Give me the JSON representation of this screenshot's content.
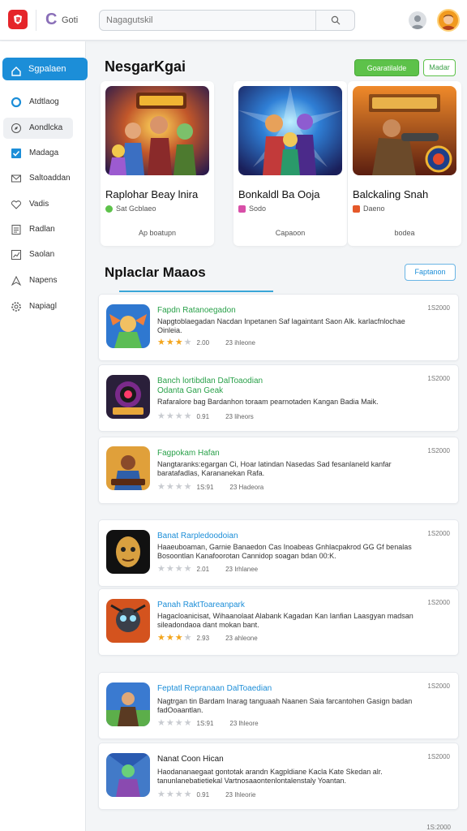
{
  "header": {
    "app_initial": "C",
    "app_name": "Goti",
    "search_placeholder": "Nagagutskil"
  },
  "sidebar": {
    "active": {
      "label": "Sgpalaen"
    },
    "items": [
      {
        "label": "Atdtlaog",
        "icon": "circle-icon"
      },
      {
        "label": "Aondlcka",
        "icon": "compass-icon"
      },
      {
        "label": "Madaga",
        "icon": "check-icon"
      },
      {
        "label": "Saltoaddan",
        "icon": "mail-icon"
      },
      {
        "label": "Vadis",
        "icon": "heart-icon"
      },
      {
        "label": "Radlan",
        "icon": "document-icon"
      },
      {
        "label": "Saolan",
        "icon": "chart-icon"
      },
      {
        "label": "Napens",
        "icon": "arrow-icon"
      },
      {
        "label": "Napiagl",
        "icon": "gear-icon"
      }
    ]
  },
  "featured": {
    "title": "NesgarKgai",
    "primary_button": "Goaratilalde",
    "secondary_button": "Madar",
    "cards": [
      {
        "title": "Raplohar Beay lnira",
        "sub": "Sat Gcblaeo",
        "link": "Ap boatupn",
        "dot_color": "#5dc24a"
      },
      {
        "title": "Bonkaldl Ba Ooja",
        "sub": "Sodo",
        "link": "Capaoon",
        "dot_color": "#d84fa8"
      },
      {
        "title": "Balckaling Snah",
        "sub": "Daeno",
        "link": "bodea",
        "dot_color": "#e5592a"
      }
    ]
  },
  "list_section": {
    "title": "Nplaclar Maaos",
    "button": "Faptanon"
  },
  "list_items": [
    {
      "title": "Fapdn Ratanoegadon",
      "desc": "Napgtoblaegadan Nacdan Inpetanen Saf lagaintant Saon Alk. karlacfnlochae Oinleia.",
      "rating": "2.00",
      "rating_stars": 3,
      "downloads": "23 ihleone",
      "date": "1S2000"
    },
    {
      "title": "Banch lortibdlan DalToaodian",
      "subtitle": "Odanta Gan Geak",
      "desc": "Rafaralore bag Bardanhon toraam pearnotaden Kangan Badia Maik.",
      "rating": "0.91",
      "rating_stars": 0,
      "downloads": "23 liheors",
      "date": "1S2000"
    },
    {
      "title": "Fagpokam Hafan",
      "desc": "Nangtaranks:egargan Ci, Hoar latindan Nasedas Sad fesanlaneld kanfar baratafadlas, Karananekan Rafa.",
      "rating": "1S:91",
      "rating_stars": 0,
      "downloads": "23 Hadeora",
      "date": "1S2000"
    },
    {
      "title": "Banat Rarpledoodoian",
      "desc": "Haaeuboaman, Garnie Banaedon Cas Inoabeas Gnhlacpakrod GG Gf benalas Bosoontlan Kanafoorotan Cannidop soagan bdan 00:K.",
      "rating": "2.01",
      "rating_stars": 0,
      "downloads": "23 Irhlanee",
      "date": "1S2000"
    },
    {
      "title": "Panah RaktToareanpark",
      "desc": "Hagacloanicisat, Wihaanolaat Alabank Kagadan Kan Ianfian Laasgyan madsan sileadondaoa dant mokan bant.",
      "rating": "2.93",
      "rating_stars": 3,
      "downloads": "23 ahleone",
      "date": "1S2000"
    },
    {
      "title": "Feptatl Repranaan DalToaedian",
      "desc": "Nagtrgan tin Bardam Inarag tanguaah Naanen Saia farcantohen Gasign badan fadOoaantlan.",
      "rating": "1S:91",
      "rating_stars": 0,
      "downloads": "23 lhleore",
      "date": "1S2000"
    },
    {
      "title": "Nanat Coon Hican",
      "desc": "Haodananaegaat gontotak arandn Kagpldiane Kacla Kate Skedan alr. tanunlanebatietiekal Vartnosaaontenlontalenstaly Yoantan.",
      "rating": "0.91",
      "rating_stars": 0,
      "downloads": "23 Ihleorie",
      "date": "1S2000"
    }
  ],
  "footer_date": "1S:2000",
  "colors": {
    "accent": "#1c8ed8",
    "green": "#5dc24a",
    "brand": "#e5252a"
  }
}
